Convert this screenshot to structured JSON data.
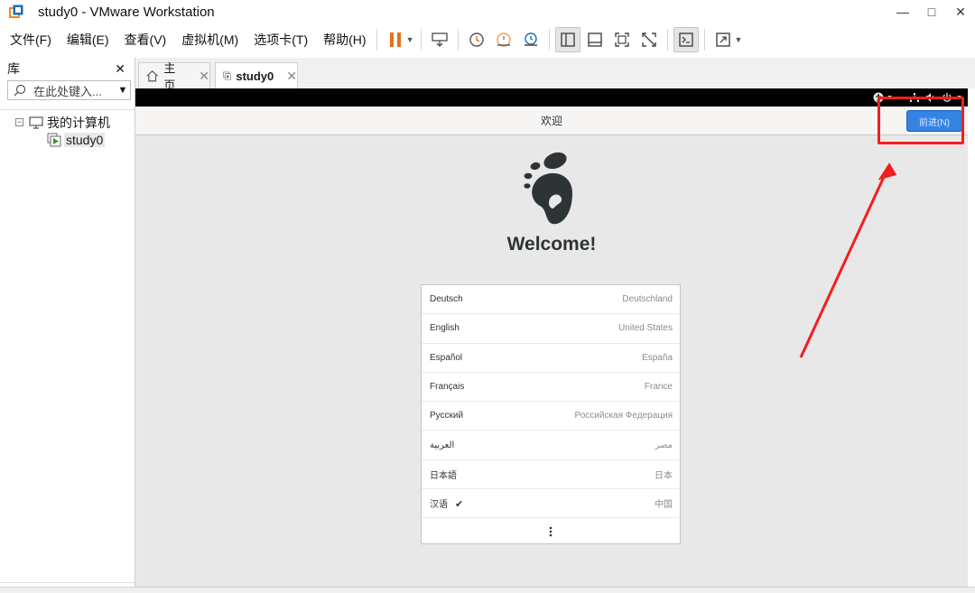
{
  "window": {
    "title": "study0 - VMware Workstation"
  },
  "menu": {
    "items": [
      "文件(F)",
      "编辑(E)",
      "查看(V)",
      "虚拟机(M)",
      "选项卡(T)",
      "帮助(H)"
    ]
  },
  "library": {
    "title": "库",
    "search_placeholder": "在此处键入...",
    "tree": {
      "root": "我的计算机",
      "vm": "study0"
    }
  },
  "tabs": [
    {
      "label": "主页"
    },
    {
      "label": "study0"
    }
  ],
  "vm": {
    "header_title": "欢迎",
    "next_button": "前进(N)",
    "welcome": "Welcome!",
    "languages": [
      {
        "name": "Deutsch",
        "region": "Deutschland",
        "selected": false
      },
      {
        "name": "English",
        "region": "United States",
        "selected": false
      },
      {
        "name": "Español",
        "region": "España",
        "selected": false
      },
      {
        "name": "Français",
        "region": "France",
        "selected": false
      },
      {
        "name": "Русский",
        "region": "Российская Федерация",
        "selected": false
      },
      {
        "name": "العربية",
        "region": "مصر",
        "selected": false
      },
      {
        "name": "日本語",
        "region": "日本",
        "selected": false
      },
      {
        "name": "汉语",
        "region": "中国",
        "selected": true
      }
    ]
  },
  "colors": {
    "accent": "#3584e4",
    "annotation": "#f51d1d",
    "pause": "#e8711c"
  }
}
